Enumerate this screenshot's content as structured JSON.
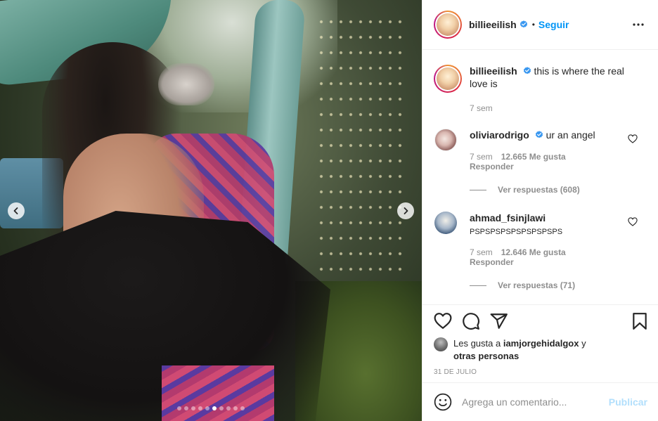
{
  "post": {
    "carousel": {
      "slide_count": 10,
      "active_index": 5
    },
    "icons": {
      "prev": "chevron-left-icon",
      "next": "chevron-right-icon"
    }
  },
  "header": {
    "username": "billieeilish",
    "verified_icon": "verified-badge-icon",
    "separator": "•",
    "follow_label": "Seguir",
    "more_icon": "more-options-icon"
  },
  "caption": {
    "username": "billieeilish",
    "text": "this is where the real love is",
    "time": "7 sem"
  },
  "comments": [
    {
      "username": "oliviarodrigo",
      "text": "ur an angel",
      "time": "7 sem",
      "likes": "12.665 Me gusta",
      "reply_label": "Responder",
      "view_replies": "Ver respuestas (608)"
    },
    {
      "username": "ahmad_fsinjlawi",
      "text": "PSPSPSPSPSPSPSPSPS",
      "time": "7 sem",
      "likes": "12.646 Me gusta",
      "reply_label": "Responder",
      "view_replies": "Ver respuestas (71)"
    }
  ],
  "actions": {
    "icons": [
      "heart-icon",
      "comment-icon",
      "share-icon",
      "bookmark-icon"
    ],
    "likes_prefix": "Les gusta a",
    "likes_user": "iamjorgehidalgox",
    "likes_conj": "y",
    "likes_others": "otras personas",
    "date": "31 DE JULIO"
  },
  "add_comment": {
    "emoji_icon": "emoji-icon",
    "placeholder": "Agrega un comentario...",
    "publish_label": "Publicar"
  },
  "colors": {
    "accent": "#0095f6",
    "publish_disabled": "#b2dffc",
    "secondary_text": "#8e8e8e",
    "border": "#efefef"
  }
}
